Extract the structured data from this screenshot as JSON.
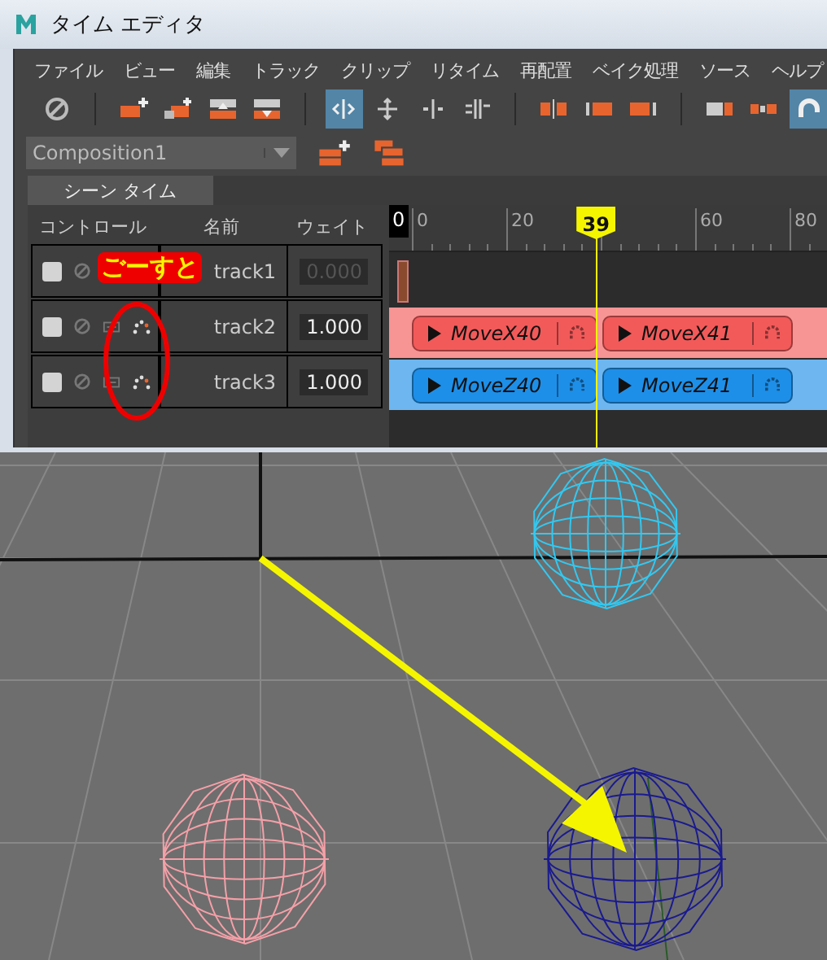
{
  "window": {
    "title": "タイム エディタ"
  },
  "menu": [
    "ファイル",
    "ビュー",
    "編集",
    "トラック",
    "クリップ",
    "リタイム",
    "再配置",
    "ベイク処理",
    "ソース",
    "ヘルプ"
  ],
  "toolbar": [
    [
      {
        "kind": "mute",
        "selected": false
      }
    ],
    [
      {
        "kind": "add-track",
        "selected": false
      },
      {
        "kind": "add-group",
        "selected": false
      },
      {
        "kind": "move-up",
        "selected": false
      },
      {
        "kind": "move-down",
        "selected": false
      }
    ],
    [
      {
        "kind": "ripple",
        "selected": true
      },
      {
        "kind": "move",
        "selected": false
      },
      {
        "kind": "split",
        "selected": false
      },
      {
        "kind": "merge",
        "selected": false
      }
    ],
    [
      {
        "kind": "trim-start",
        "selected": false
      },
      {
        "kind": "trim-center",
        "selected": false
      },
      {
        "kind": "trim-end",
        "selected": false
      }
    ],
    [
      {
        "kind": "clip-a",
        "selected": false
      },
      {
        "kind": "clip-b",
        "selected": false
      },
      {
        "kind": "snap",
        "selected": true
      }
    ]
  ],
  "composition": {
    "value": "Composition1"
  },
  "tab": {
    "label": "シーン タイム",
    "selected": true
  },
  "columns": [
    "コントロール",
    "名前",
    "ウェイト"
  ],
  "ruler": {
    "start": "0",
    "labels": [
      "0",
      "20",
      "60",
      "80"
    ],
    "playhead": "39"
  },
  "tracks": [
    {
      "kind": "empty",
      "name": "track1",
      "checked": false,
      "weight": "0.000",
      "weight_disabled": true
    },
    {
      "kind": "clips",
      "name": "track2",
      "checked": false,
      "weight": "1.000",
      "weight_disabled": false,
      "color": "#f25a5a",
      "clips": [
        "MoveX40",
        "MoveX41"
      ]
    },
    {
      "kind": "clips",
      "name": "track3",
      "checked": false,
      "weight": "1.000",
      "weight_disabled": false,
      "color": "#1e8fe8",
      "clips": [
        "MoveZ40",
        "MoveZ41"
      ]
    }
  ],
  "annotation": {
    "label": "ごーすと"
  }
}
